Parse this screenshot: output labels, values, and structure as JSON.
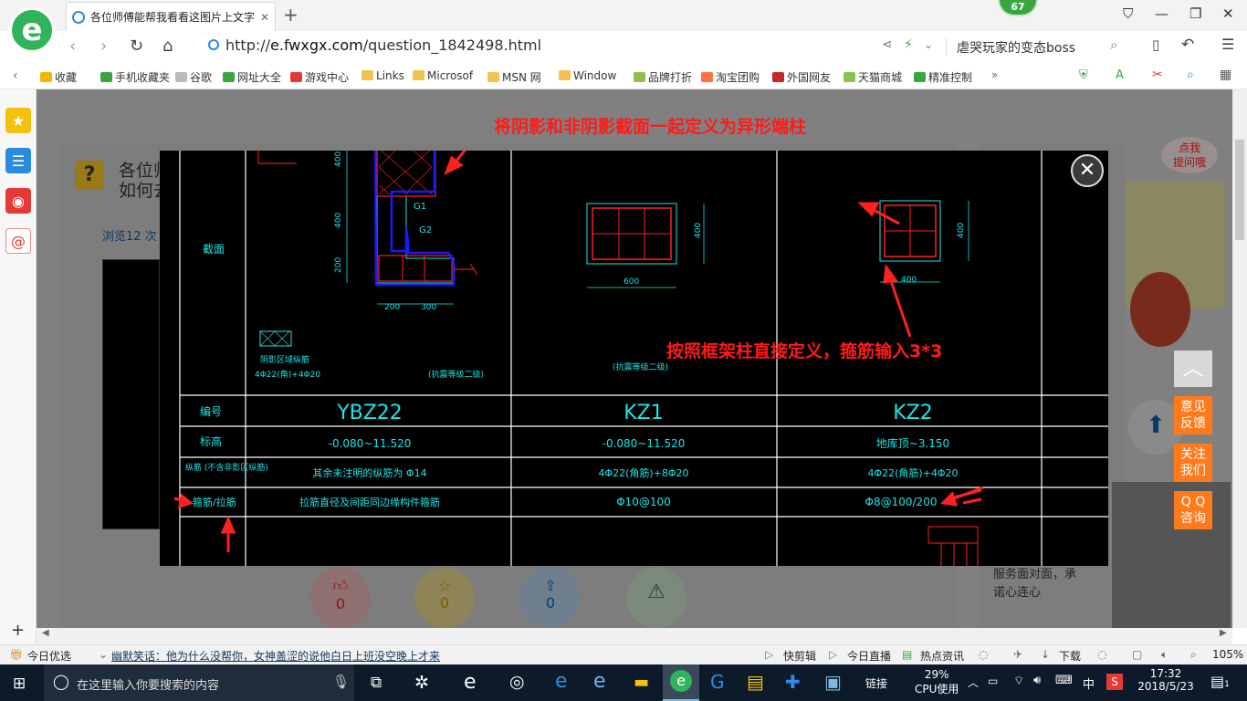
{
  "browser": {
    "tab_title": "各位师傅能帮我看看这图片上文字",
    "badge_count": "67",
    "url_scheme": "http://",
    "url_domain": "e.fwxgx.com",
    "url_path": "/question_1842498.html",
    "search_text": "虐哭玩家的变态boss"
  },
  "favorites": [
    {
      "label": "收藏",
      "color": "#f4b400"
    },
    {
      "label": "手机收藏夹",
      "color": "#3aa640"
    },
    {
      "label": "谷歌",
      "color": "#bbbbbb"
    },
    {
      "label": "网址大全",
      "color": "#3aa640"
    },
    {
      "label": "游戏中心",
      "color": "#e53935"
    },
    {
      "label": "Links",
      "color": "#f2c14e"
    },
    {
      "label": "Microsof",
      "color": "#f2c14e"
    },
    {
      "label": "MSN 网",
      "color": "#f2c14e"
    },
    {
      "label": "Window",
      "color": "#f2c14e"
    },
    {
      "label": "品牌打折",
      "color": "#8bc34a"
    },
    {
      "label": "淘宝团购",
      "color": "#ff7043"
    },
    {
      "label": "外国网友",
      "color": "#c62828"
    },
    {
      "label": "天猫商城",
      "color": "#8bc34a"
    },
    {
      "label": "精准控制",
      "color": "#3aa640"
    }
  ],
  "page": {
    "question_title_1": "各位师",
    "question_title_2": "如何去",
    "views": "浏览12 次",
    "mascot_text": "点我\n提问哦",
    "like_count": "0",
    "star_count": "0",
    "share_count": "0",
    "right_text_1": "服务面对面，承",
    "right_text_2": "诺心连心",
    "side_buttons": [
      "意见\n反馈",
      "关注\n我们",
      "Q Q\n咨询"
    ]
  },
  "drawing": {
    "annotation_top": "将阴影和非阴影截面一起定义为异形端柱",
    "annotation_mid": "按照框架柱直接定义，箍筋输入3*3",
    "row_labels": [
      "截面",
      "编号",
      "标高",
      "纵筋\n(不含非影区纵筋)",
      "箍筋/拉筋"
    ],
    "columns": [
      {
        "id": "YBZ22",
        "elev": "-0.080~11.520",
        "rebar": "其余未注明的纵筋为 Φ14",
        "stirrup": "拉筋直径及间距同边缘构件箍筋"
      },
      {
        "id": "KZ1",
        "elev": "-0.080~11.520",
        "rebar": "4Φ22(角筋)+8Φ20",
        "stirrup": "Φ10@100"
      },
      {
        "id": "KZ2",
        "elev": "地库顶~3.150",
        "rebar": "4Φ22(角筋)+4Φ20",
        "stirrup": "Φ8@100/200"
      }
    ],
    "dims": {
      "ybz_400a": "400",
      "ybz_400b": "400",
      "ybz_200": "200",
      "ybz_w1": "200",
      "ybz_w2": "300",
      "kz1_w": "600",
      "kz1_h": "400",
      "kz2_w": "400",
      "kz2_h": "400"
    },
    "g_labels": [
      "G1",
      "G2"
    ],
    "legend_text": "阴影区域纵筋",
    "legend_rebar": "4Φ22(角)+4Φ20",
    "grade_ybz": "(抗震等级二级)",
    "grade_kz1": "(抗震等级二级)"
  },
  "status": {
    "left": "今日优选",
    "news": "幽默笑话：他为什么没帮你，女神盖涩的说他白日上班没空晚上才来",
    "items": [
      "快剪辑",
      "今日直播",
      "热点资讯",
      "下载"
    ],
    "zoom": "105%"
  },
  "taskbar": {
    "search_placeholder": "在这里输入你要搜索的内容",
    "link_label": "链接",
    "cpu_pct": "29%",
    "cpu_label": "CPU使用",
    "ime": "中",
    "time": "17:32",
    "date": "2018/5/23",
    "notif": "1"
  }
}
